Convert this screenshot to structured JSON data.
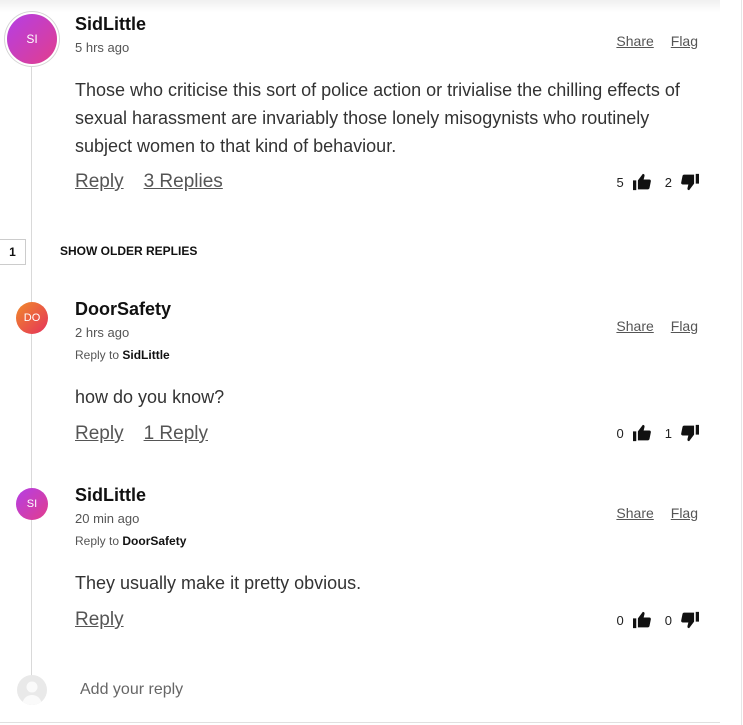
{
  "comments": [
    {
      "avatar": "SI",
      "author": "SidLittle",
      "time": "5 hrs ago",
      "share": "Share",
      "flag": "Flag",
      "text": "Those who criticise this sort of police action or trivialise the chilling effects of sexual harassment are invariably those lonely misogynists who routinely subject women to that kind of behaviour.",
      "reply": "Reply",
      "replies": "3 Replies",
      "upvotes": "5",
      "downvotes": "2"
    },
    {
      "avatar": "DO",
      "author": "DoorSafety",
      "time": "2 hrs ago",
      "reply_to_label": "Reply to",
      "reply_to": "SidLittle",
      "share": "Share",
      "flag": "Flag",
      "text": "how do you know?",
      "reply": "Reply",
      "replies": "1 Reply",
      "upvotes": "0",
      "downvotes": "1"
    },
    {
      "avatar": "SI",
      "author": "SidLittle",
      "time": "20 min ago",
      "reply_to_label": "Reply to",
      "reply_to": "DoorSafety",
      "share": "Share",
      "flag": "Flag",
      "text": "They usually make it pretty obvious.",
      "reply": "Reply",
      "upvotes": "0",
      "downvotes": "0"
    }
  ],
  "older_replies": {
    "count": "1",
    "label": "SHOW OLDER REPLIES"
  },
  "add_reply": {
    "placeholder": "Add your reply"
  },
  "icons": {
    "upvote": "thumbs-up-icon",
    "downvote": "thumbs-down-icon",
    "user": "user-placeholder-icon"
  }
}
